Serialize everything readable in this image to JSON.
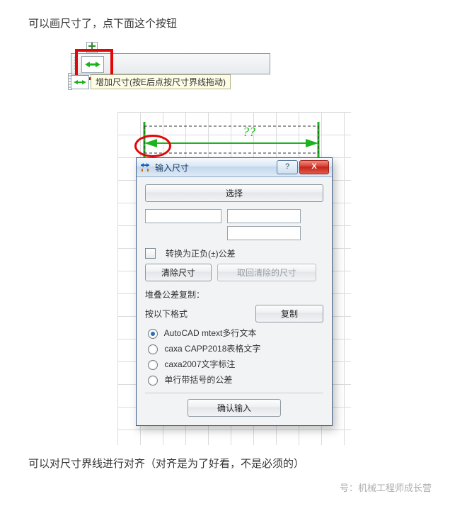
{
  "para1": "可以画尺寸了，点下面这个按钮",
  "fig1": {
    "tooltip": "增加尺寸(按E后点按尺寸界线拖动)"
  },
  "dim_placeholder": "??",
  "dialog": {
    "title": "输入尺寸",
    "help": "?",
    "close": "X",
    "select_btn": "选择",
    "input_left": "",
    "input_right_top": "",
    "input_right_bottom": "",
    "convert_tolerance": "转换为正负(±)公差",
    "clear_btn": "清除尺寸",
    "recall_btn": "取回清除的尺寸",
    "stack_label": "堆叠公差复制：",
    "format_label": "按以下格式",
    "copy_btn": "复制",
    "options": [
      "AutoCAD mtext多行文本",
      "caxa CAPP2018表格文字",
      "caxa2007文字标注",
      "单行带括号的公差"
    ],
    "ok_btn": "确认输入"
  },
  "para2": "可以对尺寸界线进行对齐（对齐是为了好看，不是必须的）",
  "watermark": "号：机械工程师成长营"
}
